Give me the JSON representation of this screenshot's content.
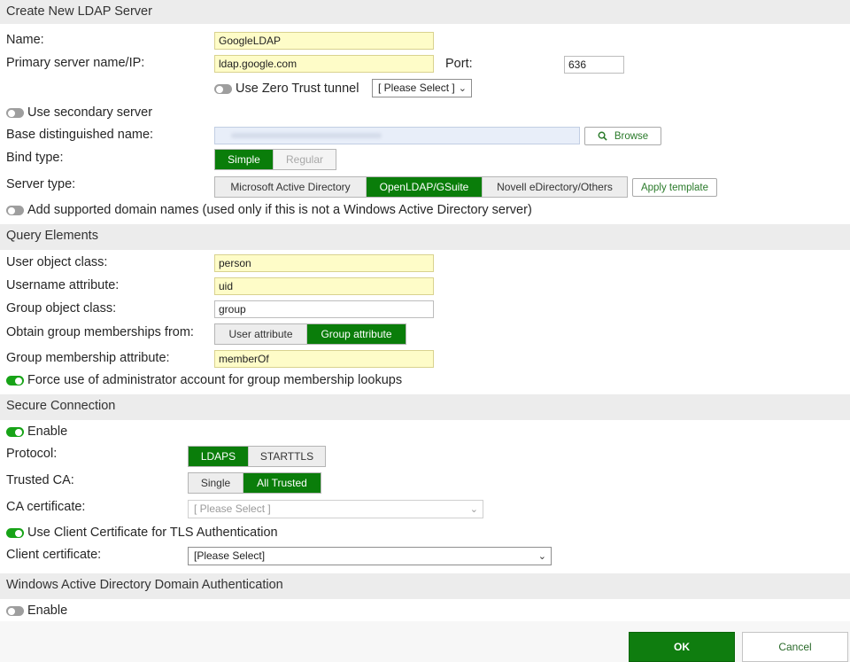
{
  "dialog": {
    "title": "Create New LDAP Server"
  },
  "general": {
    "name_label": "Name:",
    "name_value": "GoogleLDAP",
    "server_label": "Primary server name/IP:",
    "server_value": "ldap.google.com",
    "port_label": "Port:",
    "port_value": "636",
    "zero_trust_label": "Use Zero Trust tunnel",
    "zero_trust_select": "[ Please Select ]",
    "secondary_label": "Use secondary server",
    "base_dn_label": "Base distinguished name:",
    "browse_label": "Browse",
    "bind_type_label": "Bind type:",
    "bind_options": [
      "Simple",
      "Regular"
    ],
    "server_type_label": "Server type:",
    "server_types": [
      "Microsoft Active Directory",
      "OpenLDAP/GSuite",
      "Novell eDirectory/Others"
    ],
    "apply_template_label": "Apply template",
    "domain_names_label": "Add supported domain names (used only if this is not a Windows Active Directory server)"
  },
  "query": {
    "title": "Query Elements",
    "user_class_label": "User object class:",
    "user_class_value": "person",
    "username_attr_label": "Username attribute:",
    "username_attr_value": "uid",
    "group_class_label": "Group object class:",
    "group_class_value": "group",
    "obtain_label": "Obtain group memberships from:",
    "obtain_options": [
      "User attribute",
      "Group attribute"
    ],
    "membership_attr_label": "Group membership attribute:",
    "membership_attr_value": "memberOf",
    "force_admin_label": "Force use of administrator account for group membership lookups"
  },
  "secure": {
    "title": "Secure Connection",
    "enable_label": "Enable",
    "protocol_label": "Protocol:",
    "protocol_options": [
      "LDAPS",
      "STARTTLS"
    ],
    "trusted_ca_label": "Trusted CA:",
    "trusted_ca_options": [
      "Single",
      "All Trusted"
    ],
    "ca_cert_label": "CA certificate:",
    "ca_cert_select": "[ Please Select ]",
    "client_cert_toggle_label": "Use Client Certificate for TLS Authentication",
    "client_cert_label": "Client certificate:",
    "client_cert_select": "[Please Select]"
  },
  "windows_ad": {
    "title": "Windows Active Directory Domain Authentication",
    "enable_label": "Enable"
  },
  "footer": {
    "ok_label": "OK",
    "cancel_label": "Cancel"
  },
  "colors": {
    "accent": "#0a7d0a",
    "required_field": "#fefcc8",
    "toggle_on": "#17a317",
    "toggle_off": "#9e9e9e"
  },
  "icons": {
    "browse": "search-icon",
    "select": "chevron-down-icon"
  }
}
